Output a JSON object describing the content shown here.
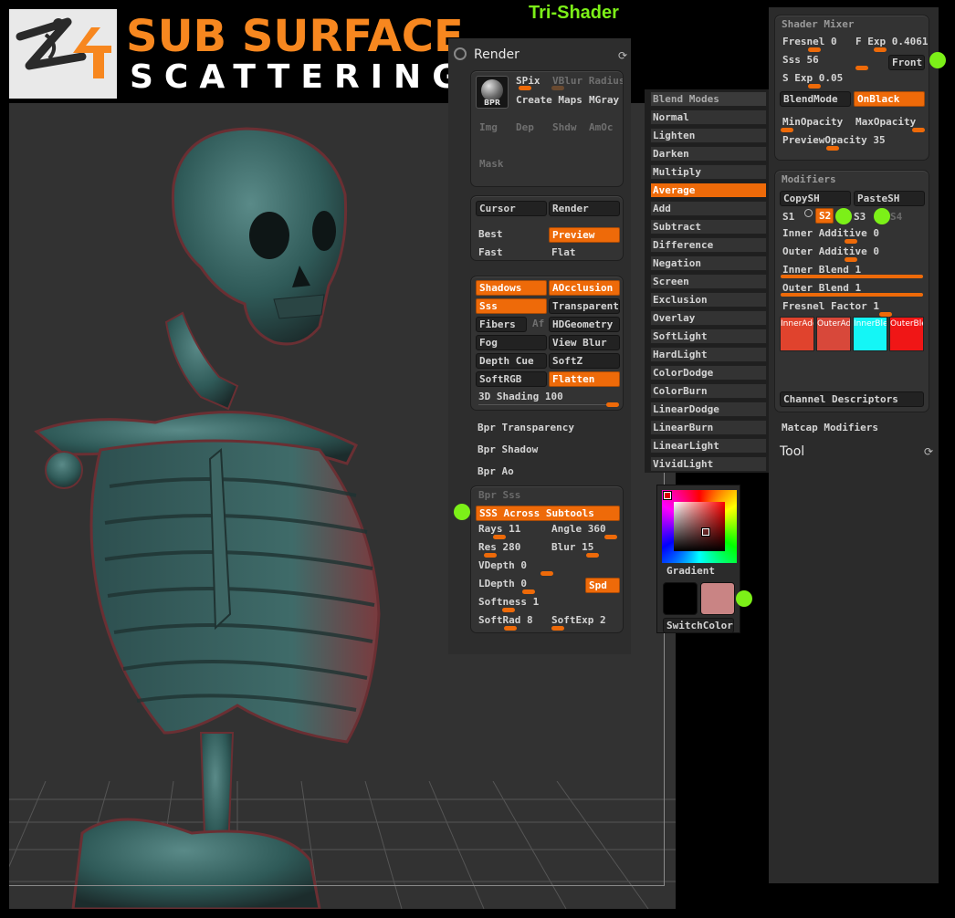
{
  "header": {
    "title_line1": "SUB SURFACE",
    "title_line2": "SCATTERING",
    "section_label": "Tri-Shader",
    "logo_icon": "zbrush-4-logo-icon"
  },
  "render": {
    "title": "Render",
    "bpr": {
      "ball_label": "BPR",
      "spix": "SPix",
      "vblur_radius": "VBlur Radius",
      "create_maps": "Create Maps",
      "mgray": "MGray",
      "img": "Img",
      "dep": "Dep",
      "shdw": "Shdw",
      "amoc": "AmOc",
      "mask": "Mask"
    },
    "mode": {
      "cursor": "Cursor",
      "render": "Render",
      "best": "Best",
      "preview": "Preview",
      "fast": "Fast",
      "flat": "Flat"
    },
    "options": {
      "shadows": "Shadows",
      "aocclusion": "AOcclusion",
      "sss": "Sss",
      "transparent": "Transparent",
      "fibers": "Fibers",
      "af": "Af",
      "hdgeometry": "HDGeometry",
      "fog": "Fog",
      "view_blur": "View Blur",
      "depth_cue": "Depth Cue",
      "softz": "SoftZ",
      "softrgb": "SoftRGB",
      "flatten": "Flatten",
      "shading_3d": "3D Shading 100"
    },
    "bpr_transparency": "Bpr Transparency",
    "bpr_shadow": "Bpr Shadow",
    "bpr_ao": "Bpr Ao",
    "bpr_sss": {
      "title": "Bpr Sss",
      "across_subtools": "SSS Across Subtools",
      "rays": "Rays 11",
      "angle": "Angle 360",
      "res": "Res 280",
      "blur": "Blur 15",
      "vdepth": "VDepth 0",
      "ldepth": "LDepth 0",
      "spd": "Spd",
      "softness": "Softness 1",
      "softrad": "SoftRad 8",
      "softexp": "SoftExp 2"
    }
  },
  "blend_modes": {
    "title": "Blend Modes",
    "selected": "Average",
    "items": [
      "Normal",
      "Lighten",
      "Darken",
      "Multiply",
      "Average",
      "Add",
      "Subtract",
      "Difference",
      "Negation",
      "Screen",
      "Exclusion",
      "Overlay",
      "SoftLight",
      "HardLight",
      "ColorDodge",
      "ColorBurn",
      "LinearDodge",
      "LinearBurn",
      "LinearLight",
      "VividLight"
    ]
  },
  "color_picker": {
    "gradient": "Gradient",
    "switch_color": "SwitchColor",
    "main_color": "#000000",
    "secondary_color": "#c98484"
  },
  "shader_mixer": {
    "title": "Shader Mixer",
    "fresnel": "Fresnel 0",
    "f_exp": "F Exp 0.4061",
    "sss": "Sss 56",
    "front": "Front",
    "s_exp": "S Exp 0.05",
    "blend_mode": "BlendMode",
    "on_black": "OnBlack",
    "min_opacity": "MinOpacity",
    "max_opacity": "MaxOpacity",
    "preview_opacity": "PreviewOpacity 35"
  },
  "modifiers": {
    "title": "Modifiers",
    "copy_sh": "CopySH",
    "paste_sh": "PasteSH",
    "s1": "S1",
    "s2": "S2",
    "s3": "S3",
    "s4": "S4",
    "inner_additive": "Inner Additive 0",
    "outer_additive": "Outer Additive 0",
    "inner_blend": "Inner Blend 1",
    "outer_blend": "Outer Blend 1",
    "fresnel_factor": "Fresnel Factor 1",
    "swatches": [
      {
        "label": "InnerAdd",
        "color": "#e0432d"
      },
      {
        "label": "OuterAdd",
        "color": "#d8483a"
      },
      {
        "label": "InnerBle",
        "color": "#14f6f6"
      },
      {
        "label": "OuterBle",
        "color": "#f01616"
      }
    ],
    "channel_descriptors": "Channel Descriptors"
  },
  "matcap_modifiers": "Matcap Modifiers",
  "tool": "Tool",
  "colors": {
    "accent": "#ee6a09",
    "highlight": "#7cf018",
    "title_orange": "#f7871f"
  }
}
